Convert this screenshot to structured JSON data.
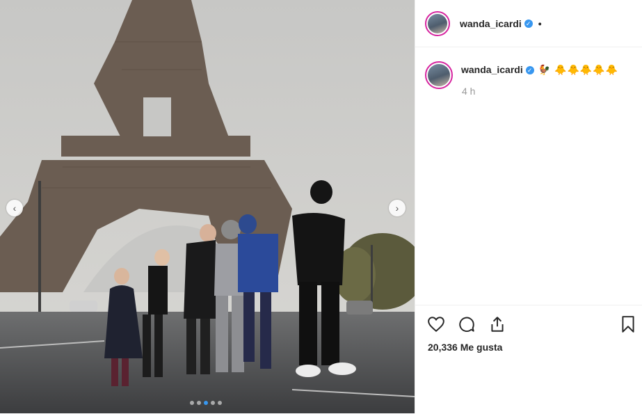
{
  "post": {
    "username": "wanda_icardi",
    "caption_text": "🐓 🐥🐥🐥🐥🐥",
    "time": "4 h",
    "likes": "20,336 Me gusta",
    "header_separator": "•"
  },
  "media": {
    "prev_glyph": "‹",
    "next_glyph": "›",
    "carousel": {
      "count": 5,
      "active": 2
    }
  },
  "icons": [
    "heart-icon",
    "comment-icon",
    "share-icon",
    "bookmark-icon",
    "verified-icon"
  ],
  "colors": {
    "accent": "#3897f0",
    "ring": "#d6249f"
  }
}
